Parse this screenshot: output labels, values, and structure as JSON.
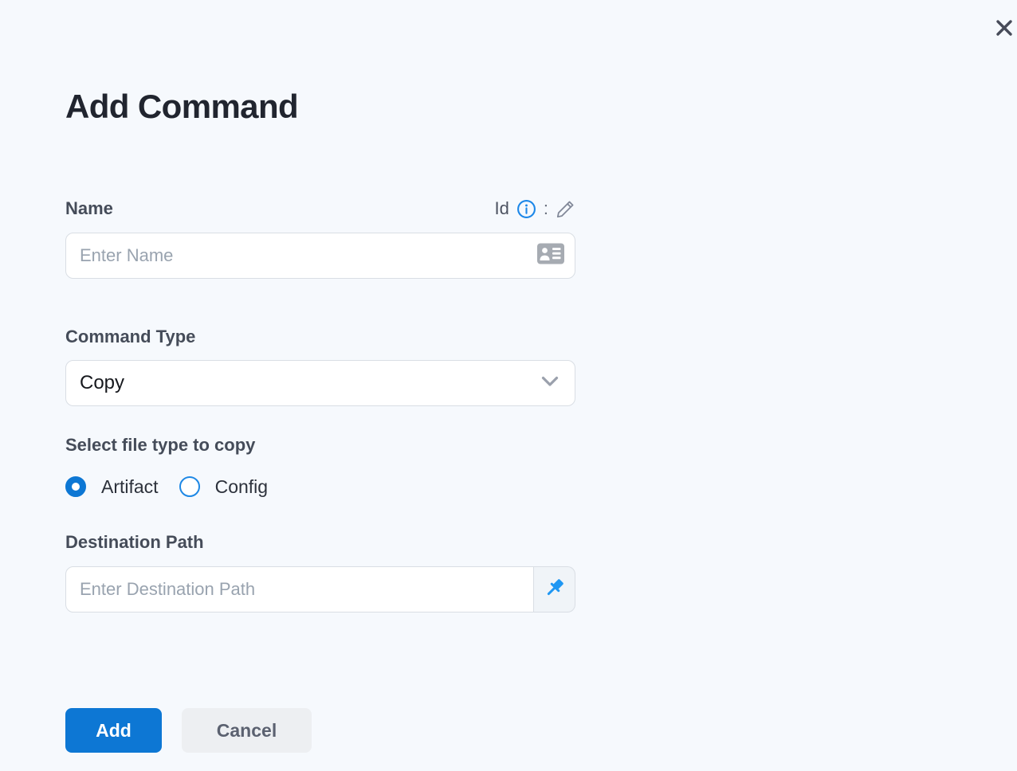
{
  "window": {
    "close_icon": "close-x"
  },
  "form": {
    "title": "Add Command",
    "name_field": {
      "label": "Name",
      "id_label": "Id",
      "colon": ":",
      "placeholder": "Enter Name",
      "value": "",
      "trailing_icon": "id-card-icon",
      "info_icon": "info-circle-icon",
      "edit_icon": "pencil-icon"
    },
    "command_type": {
      "label": "Command Type",
      "selected_value": "Copy",
      "chevron_icon": "chevron-down-icon"
    },
    "file_type": {
      "label": "Select file type to copy",
      "options": [
        {
          "label": "Artifact",
          "selected": true
        },
        {
          "label": "Config",
          "selected": false
        }
      ]
    },
    "destination": {
      "label": "Destination Path",
      "placeholder": "Enter Destination Path",
      "value": "",
      "addon_icon": "pushpin-icon"
    },
    "actions": {
      "add_label": "Add",
      "cancel_label": "Cancel"
    }
  },
  "colors": {
    "page_background": "#f6f9fd",
    "primary_blue": "#0d77d4",
    "bright_blue": "#1f97f3",
    "info_blue": "#1c87e8",
    "radio_outline_blue": "#1e88e5",
    "title_text": "#21252f",
    "label_text": "#454c59",
    "placeholder_text": "#99a3af",
    "input_border": "#d9dee4",
    "cancel_background": "#edeff2",
    "cancel_text": "#5b6170",
    "close_icon": "#474b59",
    "card_icon_gray": "#a6abb2",
    "chevron_gray": "#9aa0ac",
    "addon_background": "#f0f4f8"
  }
}
